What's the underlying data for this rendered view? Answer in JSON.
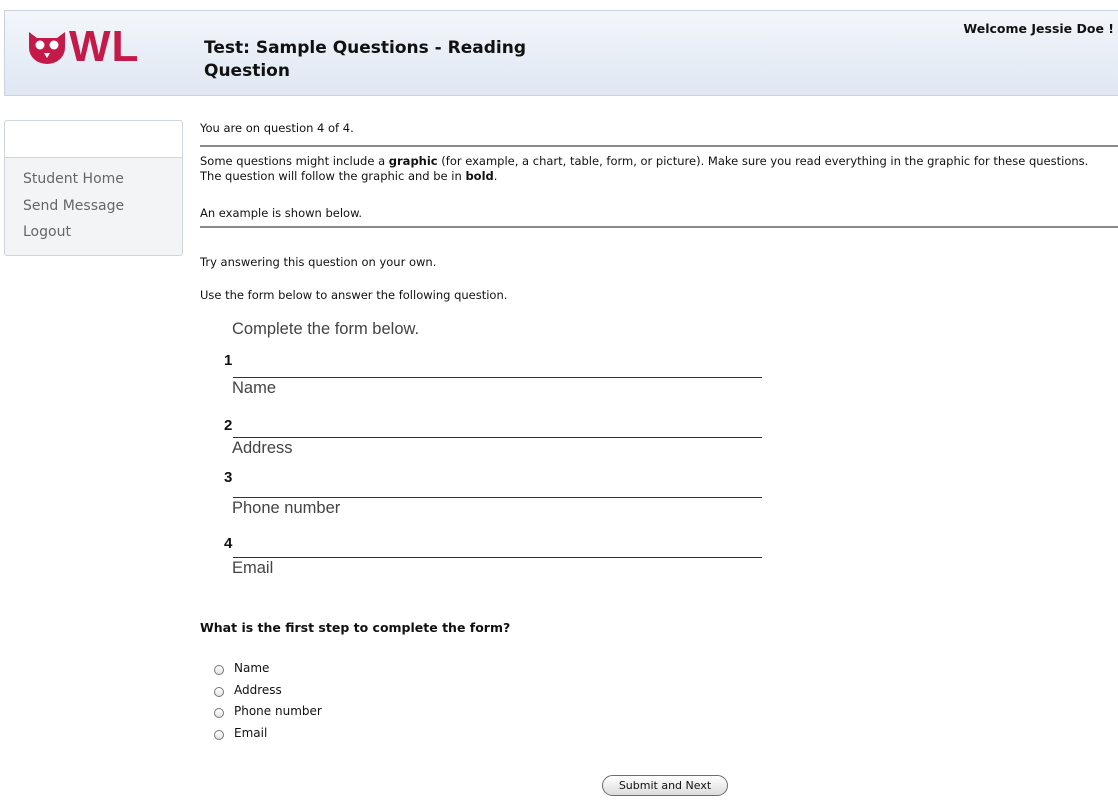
{
  "header": {
    "logo_text": "OWL",
    "title": "Test: Sample Questions - Reading Question",
    "welcome": "Welcome Jessie Doe !"
  },
  "sidebar": {
    "items": [
      {
        "label": "Student Home"
      },
      {
        "label": "Send Message"
      },
      {
        "label": "Logout"
      }
    ]
  },
  "main": {
    "progress": "You are on question 4 of 4.",
    "intro_parts": [
      "Some questions might include a ",
      "graphic",
      " (for example, a chart, table, form, or picture). Make sure you read everything in the graphic for these questions. The question will follow the graphic and be in ",
      "bold",
      "."
    ],
    "example_note": "An example is shown below.",
    "try_text": "Try answering this question on your own.",
    "use_text": "Use the form below to answer the following question.",
    "graphic": {
      "instruction": "Complete the form below.",
      "fields": [
        {
          "number": "1",
          "label": "Name"
        },
        {
          "number": "2",
          "label": "Address"
        },
        {
          "number": "3",
          "label": "Phone number"
        },
        {
          "number": "4",
          "label": "Email"
        }
      ]
    },
    "question": "What is the first step to complete the form?",
    "options": [
      "Name",
      "Address",
      "Phone number",
      "Email"
    ],
    "submit_label": "Submit and Next"
  },
  "colors": {
    "brand": "#c41a4a",
    "header_bg": "#dfe7f2",
    "rule": "#8a8a8a"
  }
}
